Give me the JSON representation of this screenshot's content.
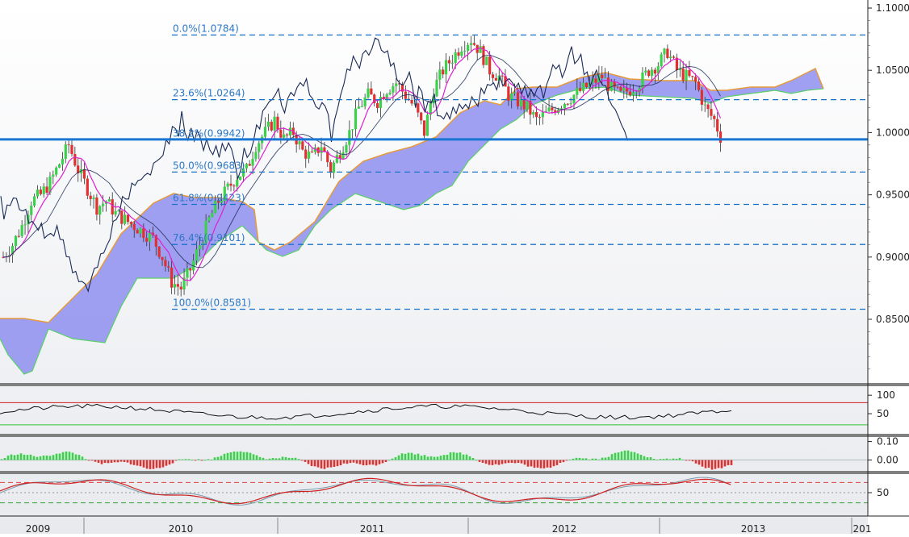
{
  "chart_data": [
    {
      "type": "candlestick",
      "title": "",
      "ylim": [
        0.8,
        1.1
      ],
      "y_ticks": [
        "1.1000",
        "1.0500",
        "1.0000",
        "0.9500",
        "0.9000",
        "0.8500"
      ],
      "y_tick_values": [
        1.1,
        1.05,
        1.0,
        0.95,
        0.9,
        0.85
      ],
      "x_ticks": [
        "2009",
        "2010",
        "2011",
        "2012",
        "2013",
        "201"
      ],
      "last_price_line": 0.9945,
      "fibonacci_levels": [
        {
          "label": "0.0%(1.0784)",
          "value": 1.0784
        },
        {
          "label": "23.6%(1.0264)",
          "value": 1.0264
        },
        {
          "label": "38.2%(0.9942)",
          "value": 0.9942
        },
        {
          "label": "50.0%(0.9683)",
          "value": 0.9683
        },
        {
          "label": "61.8%(0.9423)",
          "value": 0.9423
        },
        {
          "label": "76.4%(0.9101)",
          "value": 0.9101
        },
        {
          "label": "100.0%(0.8581)",
          "value": 0.8581
        }
      ],
      "series_close": [
        0.9,
        0.91,
        0.925,
        0.945,
        0.95,
        0.96,
        0.975,
        0.99,
        0.97,
        0.955,
        0.94,
        0.945,
        0.935,
        0.93,
        0.925,
        0.92,
        0.915,
        0.9,
        0.88,
        0.875,
        0.89,
        0.91,
        0.93,
        0.945,
        0.955,
        0.965,
        0.97,
        0.99,
        1.0,
        1.01,
        0.995,
        1.0,
        0.985,
        0.98,
        0.99,
        0.97,
        0.985,
        1.0,
        1.02,
        1.03,
        1.025,
        1.035,
        1.04,
        1.03,
        1.02,
        1.0,
        1.035,
        1.05,
        1.06,
        1.07,
        1.075,
        1.065,
        1.05,
        1.045,
        1.03,
        1.025,
        1.02,
        1.01,
        1.015,
        1.02,
        1.025,
        1.03,
        1.035,
        1.04,
        1.045,
        1.035,
        1.03,
        1.035,
        1.04,
        1.05,
        1.055,
        1.065,
        1.05,
        1.045,
        1.04,
        1.02,
        1.01,
        0.99
      ]
    },
    {
      "type": "line",
      "name": "oscillator_1",
      "y_ticks": [
        "100",
        "50"
      ],
      "y_tick_values": [
        100,
        50
      ],
      "ylim": [
        0,
        120
      ],
      "upper_level": 80,
      "lower_level": 20
    },
    {
      "type": "bar",
      "name": "oscillator_2",
      "y_ticks": [
        "0.10",
        "0.00"
      ],
      "y_tick_values": [
        0.1,
        0.0
      ],
      "ylim": [
        -0.05,
        0.12
      ]
    },
    {
      "type": "line",
      "name": "oscillator_3",
      "y_ticks": [
        "50"
      ],
      "y_tick_values": [
        50
      ],
      "ylim": [
        0,
        100
      ]
    }
  ],
  "colors": {
    "background": "#ffffff",
    "cloud": "#8f8ff0",
    "fib_line": "#1a73c9",
    "fib_text": "#2b78c7",
    "price_line": "#1976d2",
    "up_candle": "#3bd14a",
    "down_candle": "#e03030",
    "ma_magenta": "#e020d0",
    "kijun": "#1a2a55",
    "cloud_orange": "#e79a3a",
    "cloud_green": "#5ad06a",
    "separator": "#808080",
    "axis_text": "#222222"
  }
}
